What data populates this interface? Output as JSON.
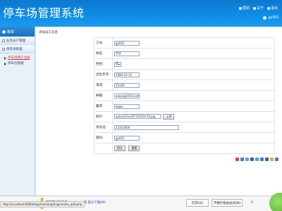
{
  "header": {
    "title": "停车场管理系统",
    "links": [
      {
        "label": "帮助",
        "icon": "help-icon"
      },
      {
        "label": "关于",
        "icon": "info-icon"
      },
      {
        "label": "退出",
        "icon": "logout-icon"
      }
    ],
    "user": "gy001"
  },
  "sidebar": {
    "title": "菜单",
    "groups": [
      {
        "label": "业务员户管理",
        "icon": "folder-icon"
      },
      {
        "label": "停车场管理",
        "icon": "folder-icon"
      }
    ],
    "sub_items": [
      {
        "label": "停车场用户注册",
        "active": true
      },
      {
        "label": "停车位管理",
        "active": false
      }
    ]
  },
  "main": {
    "breadcrumb": "添加员工信息",
    "form": {
      "fields": [
        {
          "label": "工号:",
          "value": "gy001"
        },
        {
          "label": "姓名:",
          "value": "刘全"
        },
        {
          "label": "性别:",
          "value": "男"
        },
        {
          "label": "出生年月:",
          "value": "1984-12-12"
        },
        {
          "label": "电话:",
          "value": "33330"
        },
        {
          "label": "邮箱:",
          "value": "aaaaa@163.com"
        },
        {
          "label": "籍贯:",
          "value": "wqpe"
        },
        {
          "label": "照片:",
          "value": "upload/1a/26745262c14.jpg",
          "button": "上传"
        },
        {
          "label": "身份证:",
          "value": "33333000"
        },
        {
          "label": "密码:",
          "value": "gy001"
        }
      ],
      "submit": "提交",
      "reset": "重置"
    }
  },
  "download_bar": {
    "text": "打开或保存来自 localhost 的 ",
    "link": "部分下载(M)",
    "open_label": "打开(O)",
    "never_label": "不要打扰此站点(N)"
  },
  "status_url": "http://localhost:8080/tingchechang/tingchezhu_add.php",
  "colors": {
    "header": "#0f8ee8",
    "sidebar_active": "#d33333",
    "download_accent": "#f0a818"
  }
}
